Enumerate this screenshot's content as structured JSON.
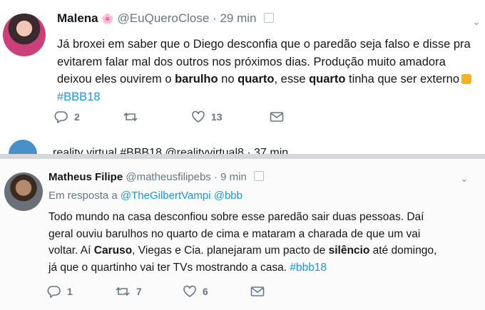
{
  "tweet1": {
    "name": "Malena",
    "flower": "🌸",
    "handle": "@EuQueroClose",
    "sep": "·",
    "time": "29 min",
    "lines": [
      [
        "Já broxei em saber que o Diego desconfia que o paredão seja falso e disse pra"
      ],
      [
        "evitarem falar mal dos outros nos próximos dias. Produção muito amadora"
      ],
      [
        "deixou eles ouvirem o ",
        "barulho",
        " no ",
        "quarto",
        ", esse ",
        "quarto",
        " tinha que ser externo"
      ],
      [
        "#BBB18"
      ]
    ],
    "actions": {
      "replies": "2",
      "retweets": "",
      "likes": "13"
    }
  },
  "peek": {
    "text": "reality virtual #BBB18 @realityvirtual8 · 37 min"
  },
  "tweet2": {
    "name": "Matheus Filipe",
    "handle": "@matheusfilipebs",
    "sep": "·",
    "time": "9 min",
    "reply_prefix": "Em resposta a",
    "reply_to_1": "@TheGilbertVampi",
    "reply_to_2": "@bbb",
    "lines": [
      [
        "Todo mundo na casa desconfiou sobre esse paredão sair duas pessoas. Daí"
      ],
      [
        "geral ouviu barulhos no quarto de cima e mataram a charada de que um vai"
      ],
      [
        "voltar. Aí ",
        "Caruso",
        ", Viegas e Cia. planejaram um pacto de ",
        "silêncio",
        " até domingo,"
      ],
      [
        "já que o quartinho vai ter TVs mostrando a casa. ",
        "#bbb18"
      ]
    ],
    "actions": {
      "replies": "1",
      "retweets": "7",
      "likes": "6"
    }
  },
  "colors": {
    "link": "#1b95e0",
    "muted": "#657786",
    "text": "#14171a"
  }
}
